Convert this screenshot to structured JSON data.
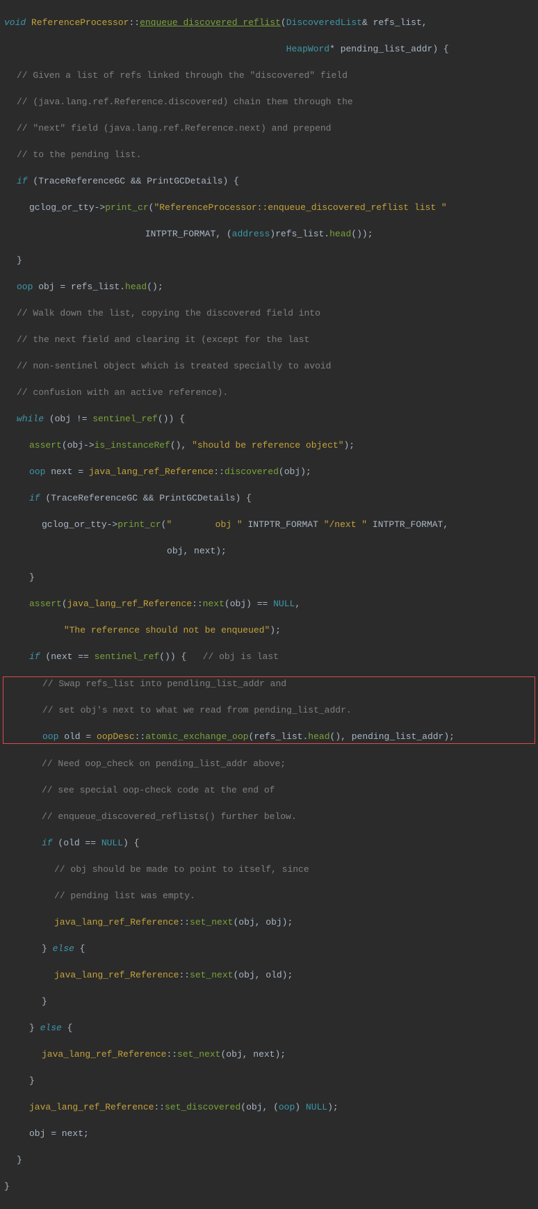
{
  "code": {
    "l1": {
      "kw_void": "void",
      "cls": "ReferenceProcessor",
      "op": "::",
      "fn": "enqueue_discovered_reflist",
      "open": "(",
      "type1": "DiscoveredList",
      "amp": "&",
      "arg1": " refs_list,"
    },
    "l2": {
      "type": "HeapWord",
      "star": "*",
      "arg": " pending_list_addr) {"
    },
    "l3": "// Given a list of refs linked through the \"discovered\" field",
    "l4": "// (java.lang.ref.Reference.discovered) chain them through the",
    "l5": "// \"next\" field (java.lang.ref.Reference.next) and prepend",
    "l6": "// to the pending list.",
    "l7": {
      "kw_if": "if",
      "open": " (TraceReferenceGC && PrintGCDetails) {"
    },
    "l8": {
      "pre": "gclog_or_tty->",
      "fn": "print_cr",
      "open": "(",
      "str": "\"ReferenceProcessor::enqueue_discovered_reflist list \""
    },
    "l9": {
      "pre": "INTPTR_FORMAT, (",
      "type": "address",
      "mid": ")refs_list.",
      "fn": "head",
      "end": "());"
    },
    "l10": "}",
    "l11": {
      "type": "oop",
      "pre": " obj = refs_list.",
      "fn": "head",
      "end": "();"
    },
    "l12": "// Walk down the list, copying the discovered field into",
    "l13": "// the next field and clearing it (except for the last",
    "l14": "// non-sentinel object which is treated specially to avoid",
    "l15": "// confusion with an active reference).",
    "l16": {
      "kw_while": "while",
      "pre": " (obj != ",
      "fn": "sentinel_ref",
      "end": "()) {"
    },
    "l17": {
      "fn": "assert",
      "open": "(obj->",
      "fn2": "is_instanceRef",
      "mid": "(), ",
      "str": "\"should be reference object\"",
      "end": ");"
    },
    "l18": {
      "type": "oop",
      "pre": " next = ",
      "cls": "java_lang_ref_Reference",
      "op": "::",
      "fn": "discovered",
      "end": "(obj);"
    },
    "l19": {
      "kw_if": "if",
      "end": " (TraceReferenceGC && PrintGCDetails) {"
    },
    "l20": {
      "pre": "gclog_or_tty->",
      "fn": "print_cr",
      "open": "(",
      "str": "\"        obj \"",
      "mid": " INTPTR_FORMAT ",
      "str2": "\"/next \"",
      "end": " INTPTR_FORMAT,"
    },
    "l21": "obj, next);",
    "l22": "}",
    "l23": {
      "fn": "assert",
      "open": "(",
      "cls": "java_lang_ref_Reference",
      "op": "::",
      "fn2": "next",
      "mid": "(obj) == ",
      "nul": "NULL",
      "end": ","
    },
    "l24": {
      "str": "\"The reference should not be enqueued\"",
      "end": ");"
    },
    "l25": {
      "kw_if": "if",
      "pre": " (next == ",
      "fn": "sentinel_ref",
      "mid": "()) {   ",
      "cmt": "// obj is last"
    },
    "l26": "// Swap refs_list into pendling_list_addr and",
    "l27": "// set obj's next to what we read from pending_list_addr.",
    "l28": {
      "type": "oop",
      "pre": " old = ",
      "cls": "oopDesc",
      "op": "::",
      "fn": "atomic_exchange_oop",
      "open": "(refs_list.",
      "fn2": "head",
      "end": "(), pending_list_addr);"
    },
    "l29": "// Need oop_check on pending_list_addr above;",
    "l30": "// see special oop-check code at the end of",
    "l31": "// enqueue_discovered_reflists() further below.",
    "l32": {
      "kw_if": "if",
      "pre": " (old == ",
      "nul": "NULL",
      "end": ") {"
    },
    "l33": "// obj should be made to point to itself, since",
    "l34": "// pending list was empty.",
    "l35": {
      "cls": "java_lang_ref_Reference",
      "op": "::",
      "fn": "set_next",
      "end": "(obj, obj);"
    },
    "l36": {
      "close": "} ",
      "kw": "else",
      "end": " {"
    },
    "l37": {
      "cls": "java_lang_ref_Reference",
      "op": "::",
      "fn": "set_next",
      "end": "(obj, old);"
    },
    "l38": "}",
    "l39": {
      "close": "} ",
      "kw": "else",
      "end": " {"
    },
    "l40": {
      "cls": "java_lang_ref_Reference",
      "op": "::",
      "fn": "set_next",
      "end": "(obj, next);"
    },
    "l41": "}",
    "l42": {
      "cls": "java_lang_ref_Reference",
      "op": "::",
      "fn": "set_discovered",
      "open": "(obj, (",
      "type": "oop",
      "mid": ") ",
      "nul": "NULL",
      "end": ");"
    },
    "l43": "obj = next;",
    "l44": "}",
    "l45": "}"
  }
}
